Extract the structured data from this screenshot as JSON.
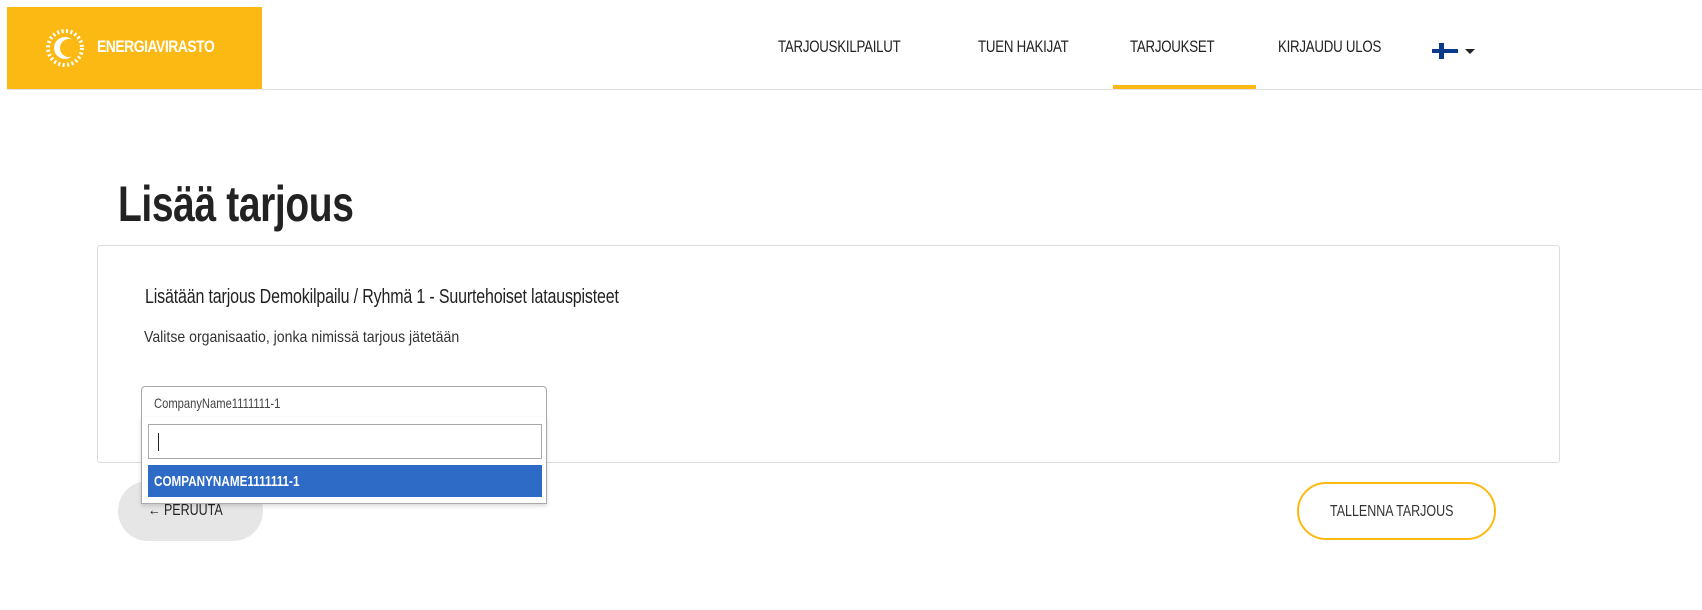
{
  "brand": {
    "name": "ENERGIAVIRASTO",
    "accent_color": "#fdb913",
    "icon": "energiavirasto-logo-icon"
  },
  "nav": {
    "items": [
      {
        "label": "TARJOUSKILPAILUT"
      },
      {
        "label": "TUEN HAKIJAT"
      },
      {
        "label": "TARJOUKSET",
        "active": true
      },
      {
        "label": "KIRJAUDU ULOS"
      }
    ],
    "language_icon": "finland-flag-icon"
  },
  "page": {
    "title": "Lisää tarjous"
  },
  "form": {
    "heading": "Lisätään tarjous Demokilpailu / Ryhmä 1 - Suurtehoiset latauspisteet",
    "org_label": "Valitse organisaatio, jonka nimissä tarjous jätetään",
    "org_selected": "CompanyName1111111-1",
    "search_value": "",
    "options": [
      {
        "label": "COMPANYNAME1111111-1",
        "highlighted": true
      }
    ],
    "highlight_color": "#2d6bc7"
  },
  "actions": {
    "cancel_label": "PERUUTA",
    "cancel_icon": "arrow-left-icon",
    "save_label": "TALLENNA TARJOUS"
  }
}
